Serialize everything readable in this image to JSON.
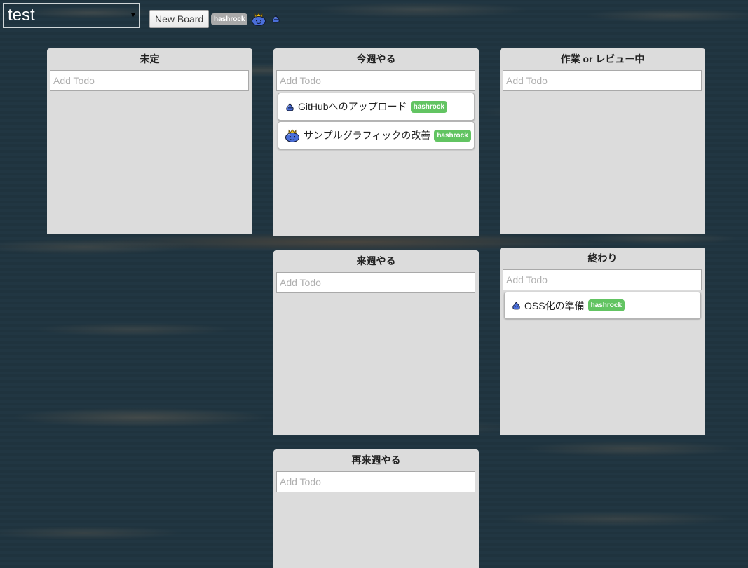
{
  "header": {
    "board_select_value": "test",
    "new_board_label": "New Board",
    "current_user": "hashrock"
  },
  "colors": {
    "background": "#213642",
    "column_background": "#dcdcdc",
    "user_badge_gray": "#a9a9a9",
    "assignee_badge_green": "#62c462",
    "slime_blue": "#4a6ed8"
  },
  "columns": [
    {
      "title": "未定",
      "placeholder": "Add Todo",
      "cards": []
    },
    {
      "title": "今週やる",
      "placeholder": "Add Todo",
      "cards": [
        {
          "icon": "small-slime-icon",
          "text": "GitHubへのアップロード",
          "assignee": "hashrock"
        },
        {
          "icon": "king-slime-icon",
          "text": "サンプルグラフィックの改善",
          "assignee": "hashrock"
        }
      ]
    },
    {
      "title": "作業 or レビュー中",
      "placeholder": "Add Todo",
      "cards": []
    },
    {
      "title": "来週やる",
      "placeholder": "Add Todo",
      "cards": []
    },
    {
      "title": "終わり",
      "placeholder": "Add Todo",
      "cards": [
        {
          "icon": "small-slime-icon",
          "text": "OSS化の準備",
          "assignee": "hashrock"
        }
      ]
    },
    {
      "title": "再来週やる",
      "placeholder": "Add Todo",
      "cards": []
    }
  ]
}
